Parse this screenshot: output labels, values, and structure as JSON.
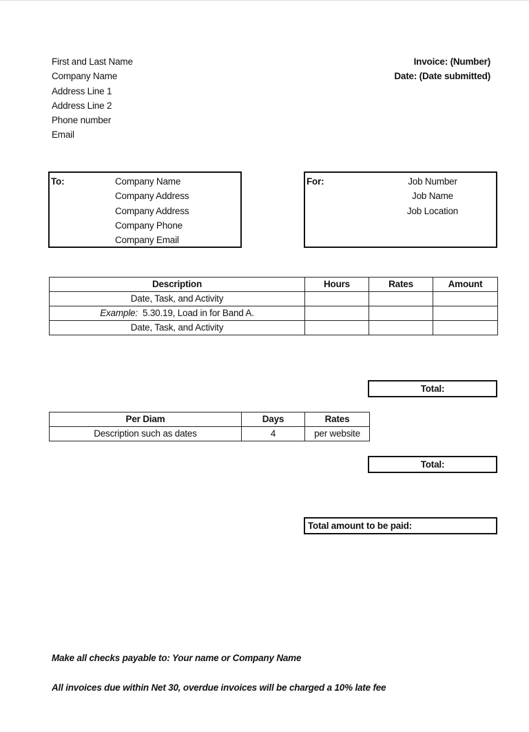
{
  "sender": {
    "lines": [
      "First and Last Name",
      "Company Name",
      "Address  Line 1",
      "Address  Line 2",
      "Phone number",
      "Email"
    ]
  },
  "invoice": {
    "number_label": "Invoice: (Number)",
    "date_label": "Date: (Date submitted)"
  },
  "to_box": {
    "label": "To:",
    "lines": [
      "Company Name",
      "Company Address",
      "Company Address",
      "Company Phone",
      "Company Email"
    ]
  },
  "for_box": {
    "label": "For:",
    "lines": [
      "Job Number",
      "Job Name",
      "Job Location"
    ]
  },
  "services_table": {
    "headers": [
      "Description",
      "Hours",
      "Rates",
      "Amount"
    ],
    "rows": [
      {
        "description": "Date, Task, and Activity",
        "hours": "",
        "rates": "",
        "amount": ""
      },
      {
        "description_prefix": "Example:",
        "description": "5.30.19, Load in for Band A.",
        "hours": "",
        "rates": "",
        "amount": ""
      },
      {
        "description": "Date, Task, and Activity",
        "hours": "",
        "rates": "",
        "amount": ""
      }
    ]
  },
  "services_total_label": "Total:",
  "per_diem_table": {
    "headers": [
      "Per Diam",
      "Days",
      "Rates"
    ],
    "rows": [
      {
        "description": "Description such as dates",
        "days": "4",
        "rates": "per website"
      }
    ]
  },
  "per_diem_total_label": "Total:",
  "grand_total_label": "Total amount to be paid:",
  "footer": {
    "checks_payable": "Make all checks payable to: Your name or Company Name",
    "terms": "All invoices due within Net 30, overdue invoices will be charged a 10% late fee"
  }
}
